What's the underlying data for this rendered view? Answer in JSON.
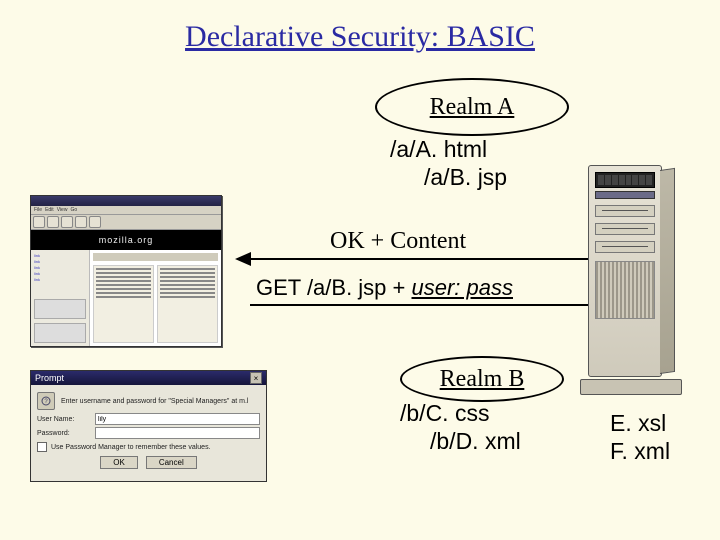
{
  "title": "Declarative Security: BASIC",
  "realms": {
    "a": {
      "label": "Realm A",
      "files": [
        "/a/A. html",
        "/a/B. jsp"
      ]
    },
    "b": {
      "label": "Realm B",
      "files": [
        "/b/C. css",
        "/b/D. xml"
      ]
    }
  },
  "root_files": [
    "E. xsl",
    "F. xml"
  ],
  "flows": {
    "response": "OK + Content",
    "request_prefix": "GET /a/B. jsp + ",
    "request_creds": "user: pass"
  },
  "browser": {
    "menus": [
      "File",
      "Edit",
      "View",
      "Go"
    ],
    "banner": "mozilla.org"
  },
  "prompt": {
    "title": "Prompt",
    "message": "Enter username and password for \"Special Managers\" at m.l",
    "user_label": "User Name:",
    "user_value": "lily",
    "pass_label": "Password:",
    "pass_value": "",
    "checkbox": "Use Password Manager to remember these values.",
    "ok": "OK",
    "cancel": "Cancel"
  }
}
